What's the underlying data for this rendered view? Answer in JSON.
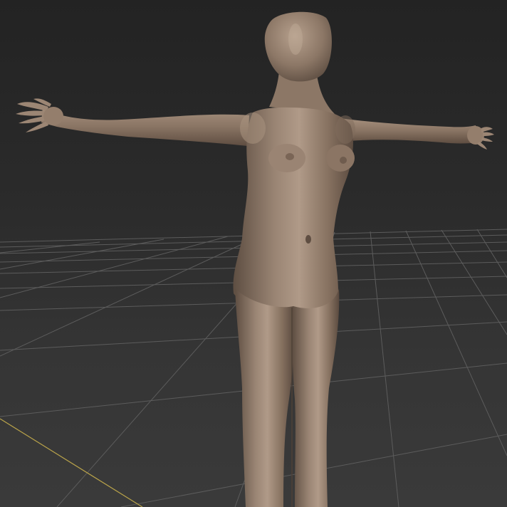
{
  "viewport": {
    "projection": "perspective",
    "grid_visible": true,
    "background_top": "#232323",
    "background_bottom": "#3a3a3a",
    "grid_color": "#5a5a5a",
    "axis_color": "#b8a24a"
  },
  "scene": {
    "object": "humanoid-base-mesh",
    "pose": "T-pose",
    "material_color": "#8a7665",
    "material_highlight": "#b09a88",
    "material_shadow": "#5e4e42"
  }
}
